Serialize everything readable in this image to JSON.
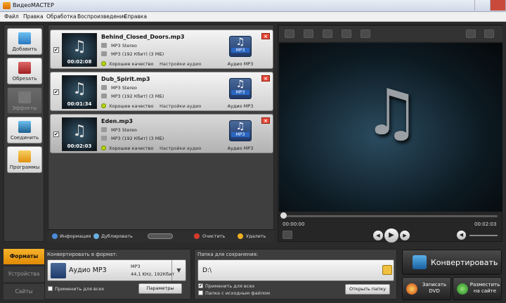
{
  "window": {
    "title": "ВидеоМАСТЕР"
  },
  "menu": [
    "Файл",
    "Правка",
    "Обработка",
    "Воспроизведение",
    "Справка"
  ],
  "tools": [
    {
      "label": "Добавить",
      "icon": "add-icon",
      "enabled": true
    },
    {
      "label": "Обрезать",
      "icon": "cut-icon",
      "enabled": true
    },
    {
      "label": "Эффекты",
      "icon": "effects-icon",
      "enabled": false
    },
    {
      "label": "Соединить",
      "icon": "join-icon",
      "enabled": true
    },
    {
      "label": "Программы",
      "icon": "programs-icon",
      "enabled": true
    }
  ],
  "files": [
    {
      "name": "Behind_Closed_Doors.mp3",
      "duration": "00:02:08",
      "stereo": "MP3 Stereo",
      "info": "MP3 (192 Кбит) (3 МБ)",
      "quality": "Хорошее качество",
      "settings": "Настройки аудио",
      "badge": "MP3",
      "format": "Аудио MP3",
      "checked": "✔"
    },
    {
      "name": "Dub_Spirit.mp3",
      "duration": "00:01:34",
      "stereo": "MP3 Stereo",
      "info": "MP3 (192 Кбит) (3 МБ)",
      "quality": "Хорошее качество",
      "settings": "Настройки аудио",
      "badge": "MP3",
      "format": "Аудио MP3",
      "checked": "✔"
    },
    {
      "name": "Eden.mp3",
      "duration": "00:02:03",
      "stereo": "MP3 Stereo",
      "info": "MP3 (192 Кбит) (3 МБ)",
      "quality": "Хорошее качество",
      "settings": "Настройки аудио",
      "badge": "MP3",
      "format": "Аудио MP3",
      "checked": "✔"
    }
  ],
  "list_toolbar": {
    "info": "Информация",
    "duplicate": "Дублировать",
    "clear": "Очистить",
    "delete": "Удалить"
  },
  "player": {
    "time_start": "00:00:00",
    "time_end": "00:02:03",
    "note_glyph": "♫"
  },
  "side_tabs": [
    "Форматы",
    "Устройства",
    "Сайты"
  ],
  "format_panel": {
    "caption": "Конвертировать в формат:",
    "format_name": "Аудио MP3",
    "detail1": "MP3",
    "detail2": "44,1 KHz, 192Кбит",
    "apply_all": "Применить для всех",
    "params": "Параметры"
  },
  "save_panel": {
    "caption": "Папка для сохранения:",
    "path": "D:\\",
    "apply_all": "Применить для всех",
    "source_folder": "Папка с исходным файлом",
    "open_folder": "Открыть папку"
  },
  "actions": {
    "convert": "Конвертировать",
    "dvd": "Записать DVD",
    "upload": "Разместить на сайте"
  },
  "colors": {
    "accent": "#f0a01a",
    "quality_dot": "#b6d400"
  }
}
